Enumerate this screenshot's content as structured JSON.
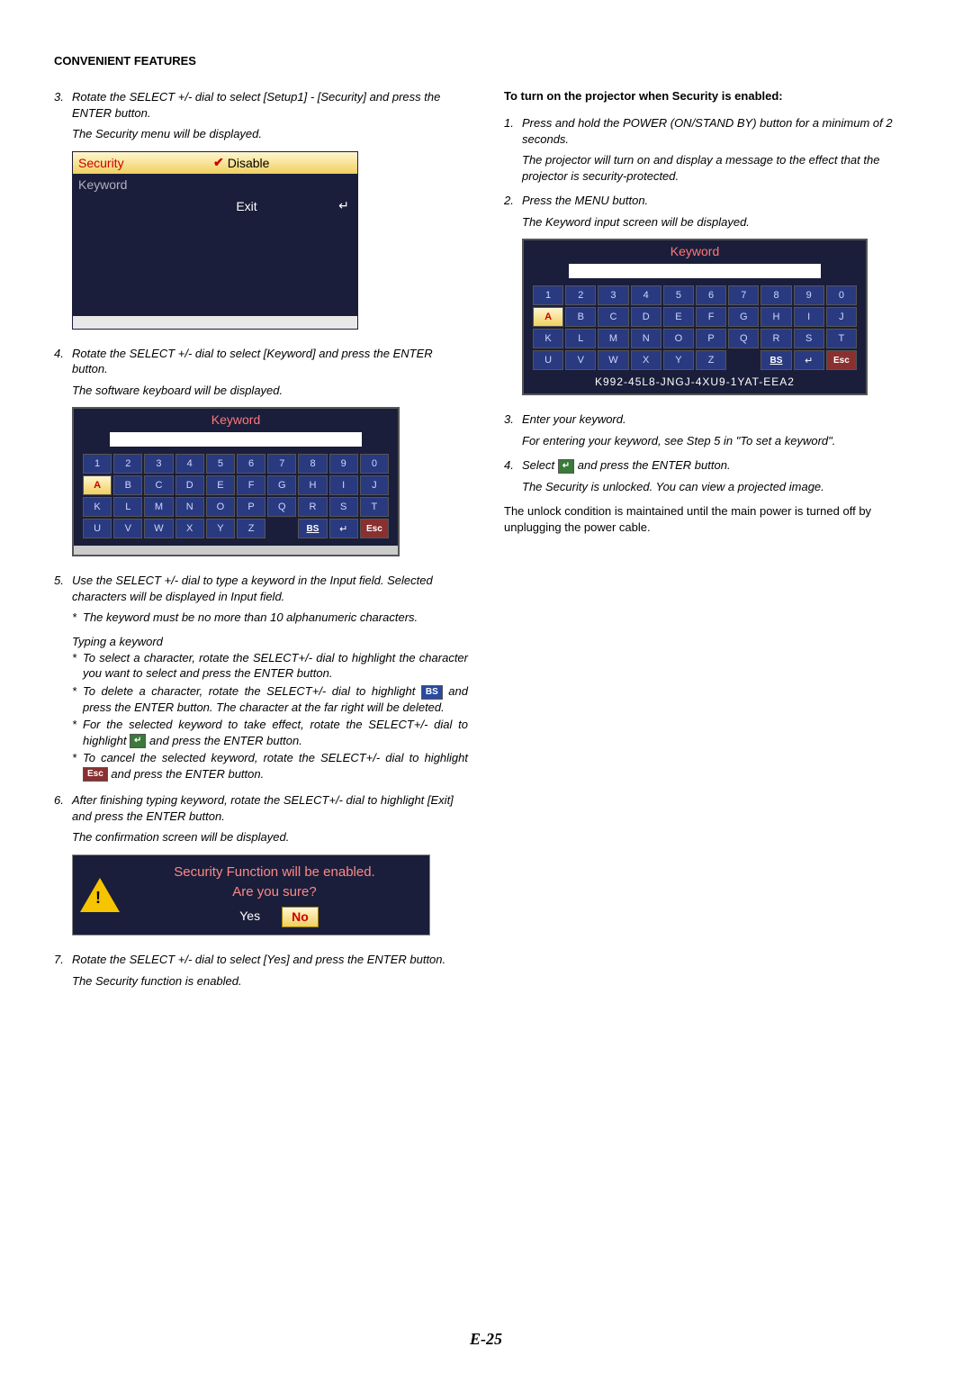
{
  "section_title": "CONVENIENT FEATURES",
  "left": {
    "step3": "Rotate the SELECT +/- dial to select [Setup1] - [Security] and press the ENTER button.",
    "step3_note": "The Security menu will be displayed.",
    "fig_security": {
      "row1_label": "Security",
      "row1_value": "Disable",
      "row2_label": "Keyword",
      "exit_label": "Exit",
      "exit_icon": "↵"
    },
    "step4": "Rotate the SELECT +/- dial to select [Keyword] and press the ENTER button.",
    "step4_note": "The software keyboard will be displayed.",
    "fig_kbd": {
      "title": "Keyword",
      "row_num": [
        "1",
        "2",
        "3",
        "4",
        "5",
        "6",
        "7",
        "8",
        "9",
        "0"
      ],
      "row_aj": [
        "A",
        "B",
        "C",
        "D",
        "E",
        "F",
        "G",
        "H",
        "I",
        "J"
      ],
      "row_kt": [
        "K",
        "L",
        "M",
        "N",
        "O",
        "P",
        "Q",
        "R",
        "S",
        "T"
      ],
      "row_uz": [
        "U",
        "V",
        "W",
        "X",
        "Y",
        "Z"
      ],
      "bs": "BS",
      "ret": "↵",
      "esc": "Esc",
      "selected": "A"
    },
    "step5": "Use the SELECT +/- dial to type a keyword in the Input field. Selected characters will be displayed in Input field.",
    "step5_star1": "The keyword must be no more than 10 alphanumeric characters.",
    "typing_hdr": "Typing a keyword",
    "typing_star1": "To select a character, rotate the SELECT+/- dial to highlight the character you want to select and press the ENTER button.",
    "typing_star2_a": "To delete a character, rotate the SELECT+/- dial to highlight ",
    "typing_star2_icon": "BS",
    "typing_star2_b": " and press the ENTER button. The character at the far right will be deleted.",
    "typing_star3_a": "For the selected keyword to take effect, rotate the SELECT+/- dial to highlight ",
    "typing_star3_icon": "↵",
    "typing_star3_b": " and press the ENTER button.",
    "typing_star4_a": "To cancel the selected keyword, rotate the SELECT+/- dial to highlight ",
    "typing_star4_icon": "Esc",
    "typing_star4_b": " and press the ENTER button.",
    "step6": "After finishing typing keyword, rotate the SELECT+/- dial to highlight [Exit] and press the ENTER button.",
    "step6_note": "The confirmation screen will be displayed.",
    "fig_confirm": {
      "line1": "Security Function will be enabled.",
      "line2": "Are you sure?",
      "yes": "Yes",
      "no": "No"
    },
    "step7": "Rotate the SELECT +/- dial to select [Yes] and press the ENTER button.",
    "step7_note": "The Security function is enabled."
  },
  "right": {
    "heading": "To turn on the projector when Security is enabled:",
    "step1": "Press and hold the POWER (ON/STAND BY) button for a minimum of 2 seconds.",
    "step1_note": "The projector will turn on and display a message to the effect that the projector is security-protected.",
    "step2": "Press the MENU button.",
    "step2_note": "The Keyword input screen will be displayed.",
    "fig_kbd": {
      "title": "Keyword",
      "row_num": [
        "1",
        "2",
        "3",
        "4",
        "5",
        "6",
        "7",
        "8",
        "9",
        "0"
      ],
      "row_aj": [
        "A",
        "B",
        "C",
        "D",
        "E",
        "F",
        "G",
        "H",
        "I",
        "J"
      ],
      "row_kt": [
        "K",
        "L",
        "M",
        "N",
        "O",
        "P",
        "Q",
        "R",
        "S",
        "T"
      ],
      "row_uz": [
        "U",
        "V",
        "W",
        "X",
        "Y",
        "Z"
      ],
      "bs": "BS",
      "ret": "↵",
      "esc": "Esc",
      "selected": "A",
      "serial": "K992-45L8-JNGJ-4XU9-1YAT-EEA2"
    },
    "step3": "Enter your keyword.",
    "step3_note": "For entering your keyword, see Step 5 in \"To set a keyword\".",
    "step4_a": "Select ",
    "step4_icon": "↵",
    "step4_b": " and press the ENTER button.",
    "step4_note": "The Security is unlocked. You can view a projected image.",
    "body": "The unlock condition is maintained until the main power is turned off by unplugging the power cable."
  },
  "page_number": "E-25"
}
